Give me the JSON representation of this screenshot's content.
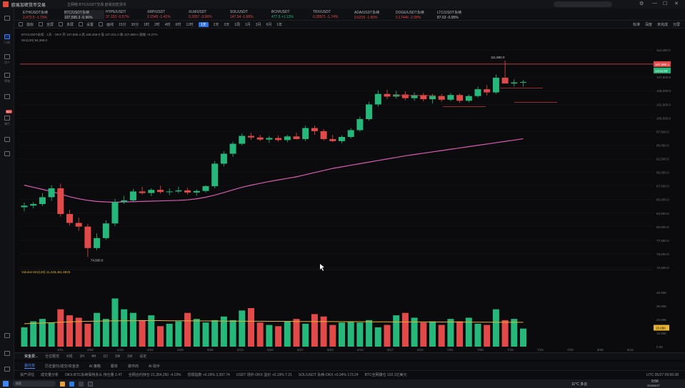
{
  "window": {
    "title": "欧易加密货币交易",
    "title_tabs": "主网络  BTC/USDT交易  欧易加密货币",
    "search_placeholder": "搜索币种 / 功能",
    "controls": [
      "—",
      "☐",
      "✕"
    ]
  },
  "sidebar": {
    "items": [
      {
        "icon": "exchange-icon",
        "label": "交易"
      },
      {
        "icon": "chart-icon",
        "label": "行情"
      },
      {
        "icon": "wallet-icon",
        "label": "资产"
      },
      {
        "icon": "bot-icon",
        "label": "策略"
      },
      {
        "icon": "earn-icon",
        "label": "赚币"
      },
      {
        "icon": "grid-icon",
        "label": "更多"
      },
      {
        "icon": "settings-icon",
        "label": "设置"
      }
    ],
    "badge": "99+"
  },
  "tickers": [
    {
      "name": "ETH/USDT永续",
      "price": "2,472.5 -1.73%",
      "dir": "down"
    },
    {
      "name": "BTC/USDT永续",
      "price": "107,595.3 -0.96%",
      "dir": "neutral",
      "active": true
    },
    {
      "name": "HYPE/USDT",
      "price": "37.153 -0.57%",
      "dir": "down"
    },
    {
      "name": "XRP/USDT",
      "price": "2.1545 -1.41%",
      "dir": "down"
    },
    {
      "name": "XLM/USDT",
      "price": "0.2657 -3.06%",
      "dir": "down"
    },
    {
      "name": "SOL/USDT",
      "price": "147.54 -1.68%",
      "dir": "down"
    },
    {
      "name": "BCH/USDT",
      "price": "477.5 +1.13%",
      "dir": "up"
    },
    {
      "name": "TRX/USDT",
      "price": "0.28571 -1.74%",
      "dir": "down"
    },
    {
      "name": "ADA/USDT永续",
      "price": "0.6215 -1.90%",
      "dir": "down"
    },
    {
      "name": "DOGE/USDT永续",
      "price": "0.17446 -2.08%",
      "dir": "down"
    },
    {
      "name": "LTC/USDT永续",
      "price": "87.63 -0.95%",
      "dir": "neutral"
    }
  ],
  "toolbar": {
    "left_items": [
      "指标",
      "全屏",
      "多屏",
      "设置",
      "画线"
    ],
    "timeframes": [
      "15分",
      "30分",
      "1时",
      "2时",
      "4时",
      "6时",
      "12时",
      "1天",
      "2天",
      "3天",
      "1周",
      "1月",
      "3月",
      "6月",
      "1年"
    ],
    "active_timeframe": "1天",
    "right_items": [
      "标准",
      "深度",
      "未完成",
      "分屏"
    ]
  },
  "chart": {
    "info_line1": "BTC/USDT永续 · 1天 · OKX  开 107,595.3  高 108,268.9  低 107,011.0  收 107,880.0  涨幅 +0.27%",
    "info_line2": "MA(120) 94,368.8",
    "high_label": "111,980.0",
    "low_label": "74,500.0",
    "current_price": "107,880.1",
    "countdown": "14:51:03",
    "volume_label": "Volume  MA(120) 11,428,461.8833",
    "volume_current": "15.68K",
    "price_axis": [
      "112,500.0",
      "110,000.0",
      "107,500.0",
      "105,000.0",
      "102,500.0",
      "100,000.0",
      "97,500.0",
      "95,000.0",
      "92,500.0",
      "90,000.0",
      "87,500.0",
      "85,000.0",
      "82,500.0",
      "80,000.0",
      "77,500.0",
      "75,000.0",
      "72,500.0"
    ],
    "volume_axis": [
      "40.00K",
      "30.00K",
      "20.00K",
      "10.00K",
      "0.00"
    ],
    "date_axis": [
      "4/01",
      "4/08",
      "4/15",
      "4/22",
      "4/29",
      "5/06",
      "5/13",
      "5/20",
      "5/27",
      "6/03",
      "6/10",
      "6/17",
      "6/24",
      "7/01",
      "7/08",
      "7/15",
      "7/22",
      "7/29",
      "8/05",
      "8/12"
    ]
  },
  "chart_data": {
    "type": "candlestick",
    "title": "BTC/USDT永续 1天",
    "x": [
      "4/02",
      "4/03",
      "4/05",
      "4/07",
      "4/09",
      "4/11",
      "4/13",
      "4/15",
      "4/17",
      "4/19",
      "4/21",
      "4/23",
      "4/25",
      "4/27",
      "4/29",
      "5/01",
      "5/03",
      "5/05",
      "5/07",
      "5/09",
      "5/11",
      "5/13",
      "5/15",
      "5/17",
      "5/19",
      "5/21",
      "5/23",
      "5/25",
      "5/27",
      "5/29",
      "5/31",
      "6/02",
      "6/04",
      "6/06",
      "6/08",
      "6/10",
      "6/12",
      "6/14",
      "6/16",
      "6/18",
      "6/20",
      "6/22",
      "6/24",
      "6/26",
      "6/28",
      "6/30",
      "7/02",
      "7/04",
      "7/06",
      "7/08",
      "7/10",
      "7/12",
      "7/14",
      "7/16",
      "7/18",
      "7/20"
    ],
    "ohlc": [
      [
        84000,
        84900,
        83200,
        84300
      ],
      [
        84300,
        85000,
        83800,
        84600
      ],
      [
        84600,
        86700,
        84200,
        85900
      ],
      [
        85900,
        88200,
        85200,
        87600
      ],
      [
        87600,
        88500,
        82200,
        82700
      ],
      [
        82700,
        83500,
        80500,
        81000
      ],
      [
        81000,
        82000,
        79500,
        80300
      ],
      [
        80300,
        80800,
        74500,
        76200
      ],
      [
        76200,
        79000,
        75800,
        78100
      ],
      [
        78100,
        81500,
        77800,
        80900
      ],
      [
        80900,
        85600,
        80400,
        85000
      ],
      [
        85000,
        86200,
        84600,
        85300
      ],
      [
        85300,
        87500,
        85000,
        87000
      ],
      [
        87000,
        87900,
        86400,
        86700
      ],
      [
        86700,
        87600,
        86100,
        87300
      ],
      [
        87300,
        88100,
        86600,
        86900
      ],
      [
        86900,
        87600,
        86300,
        87000
      ],
      [
        87000,
        87900,
        86700,
        87200
      ],
      [
        87200,
        87700,
        86400,
        86800
      ],
      [
        86800,
        87400,
        86200,
        87100
      ],
      [
        87100,
        88200,
        86800,
        88000
      ],
      [
        88000,
        92800,
        87600,
        92300
      ],
      [
        92300,
        94700,
        91800,
        94200
      ],
      [
        94200,
        96500,
        93600,
        96100
      ],
      [
        96100,
        98100,
        95800,
        97600
      ],
      [
        97600,
        98200,
        96800,
        97300
      ],
      [
        97300,
        97800,
        96600,
        96900
      ],
      [
        96900,
        97600,
        96300,
        97200
      ],
      [
        97200,
        97700,
        96500,
        96800
      ],
      [
        96800,
        97800,
        96400,
        97500
      ],
      [
        97500,
        98200,
        96900,
        97000
      ],
      [
        97000,
        99600,
        96600,
        99100
      ],
      [
        99100,
        99600,
        97800,
        98500
      ],
      [
        98500,
        98900,
        96700,
        97000
      ],
      [
        97000,
        97800,
        96400,
        96600
      ],
      [
        96600,
        97700,
        96200,
        97400
      ],
      [
        97400,
        99100,
        97100,
        98700
      ],
      [
        98700,
        101300,
        98400,
        100800
      ],
      [
        100800,
        104100,
        100500,
        103600
      ],
      [
        103600,
        106300,
        103200,
        105600
      ],
      [
        105600,
        106400,
        104600,
        105100
      ],
      [
        105100,
        106200,
        104700,
        105500
      ],
      [
        105500,
        106100,
        104400,
        104800
      ],
      [
        104800,
        105900,
        104300,
        105400
      ],
      [
        105400,
        105800,
        104200,
        104600
      ],
      [
        104600,
        105600,
        103800,
        105200
      ],
      [
        105200,
        105600,
        104100,
        104500
      ],
      [
        104500,
        105800,
        104200,
        105400
      ],
      [
        105400,
        105700,
        103900,
        104300
      ],
      [
        104300,
        105500,
        104000,
        105200
      ],
      [
        105200,
        107000,
        104900,
        106500
      ],
      [
        106500,
        107300,
        105300,
        105900
      ],
      [
        105900,
        109300,
        105600,
        108700
      ],
      [
        108700,
        111980,
        108300,
        107600
      ],
      [
        107600,
        108400,
        107000,
        107800
      ],
      [
        107800,
        108268,
        107011,
        107880
      ]
    ],
    "ma120": [
      88200,
      87800,
      87400,
      87000,
      86500,
      86000,
      85600,
      85300,
      85100,
      85000,
      84950,
      85000,
      85050,
      85100,
      85150,
      85200,
      85250,
      85300,
      85400,
      85600,
      85900,
      86300,
      86800,
      87300,
      87800,
      88200,
      88550,
      88900,
      89200,
      89500,
      89800,
      90200,
      90600,
      91000,
      91400,
      91700,
      92000,
      92300,
      92600,
      92900,
      93200,
      93500,
      93800,
      94050,
      94300,
      94550,
      94800,
      95050,
      95300,
      95550,
      95800,
      96050,
      96300,
      96550,
      96800,
      97050
    ],
    "volume": [
      16,
      21,
      23,
      20,
      31,
      26,
      24,
      19,
      28,
      23,
      40,
      31,
      28,
      22,
      26,
      17,
      19,
      21,
      28,
      23,
      20,
      22,
      25,
      22,
      30,
      32,
      20,
      18,
      17,
      21,
      23,
      19,
      27,
      25,
      18,
      20,
      21,
      20,
      22,
      16,
      18,
      26,
      28,
      24,
      20,
      21,
      18,
      23,
      21,
      24,
      19,
      18,
      31,
      22,
      23,
      15
    ],
    "volume_ma": [
      19,
      19.3,
      19.6,
      19.9,
      20.3,
      20.6,
      20.9,
      21,
      21.2,
      21.3,
      21.4,
      21.5,
      21.5,
      21.6,
      21.6,
      21.6,
      21.5,
      21.5,
      21.4,
      21.4,
      21.3,
      21.3,
      21.2,
      21.2,
      21.2,
      21.1,
      21.1,
      21,
      21,
      21,
      20.9,
      20.9,
      20.8,
      20.8,
      20.8,
      20.7,
      20.7,
      20.7,
      20.6,
      20.6,
      20.6,
      20.5,
      20.5,
      20.5,
      20.5,
      20.4,
      20.4,
      20.4,
      20.4,
      20.3,
      20.3,
      20.3,
      20.3,
      20.2,
      20.2,
      20.2
    ],
    "ylim": [
      72500,
      114000
    ],
    "volume_ylim": [
      0,
      45
    ],
    "colors": {
      "up": "#26b77a",
      "down": "#e24a4a",
      "ma": "#d85cb0",
      "volume_ma": "#e8b430",
      "price_line": "#e24a4a"
    }
  },
  "bottom_tabs": {
    "items": [
      "资金费...",
      "仓位概览",
      "K线",
      "1H",
      "4H",
      "1D",
      "1W",
      "1M",
      "设定"
    ],
    "active": 0
  },
  "bottom_tabs2": {
    "items": [
      "委托单",
      "历史委托/成交/资金流",
      "AI 策略",
      "跟单",
      "做市商",
      "AI 助手"
    ],
    "active": 0
  },
  "status": {
    "items": [
      {
        "text": "资产评估",
        "cls": "neutral"
      },
      {
        "text": "成交量分析",
        "cls": "up"
      },
      {
        "text": "OKX-BTC永续保持多头  持仓量 2.47",
        "cls": "neutral"
      },
      {
        "text": "全网合约持仓 21,354,250  -4.19%",
        "cls": "down"
      },
      {
        "text": "恐惧指数 +0.18%  3,397.74",
        "cls": "up"
      },
      {
        "text": "USDT 场外-OKX  溢价 +0.19%  7.21",
        "cls": "up"
      },
      {
        "text": "SOL/USDT 永续-OKX  +0.34%  173.24",
        "cls": "up"
      },
      {
        "text": "BTC全网爆仓 102.1亿美元",
        "cls": "neutral"
      }
    ],
    "server_time": "UTC 05/27 09:56:38"
  },
  "taskbar": {
    "search_placeholder": "搜索",
    "weather": "11°C 多云",
    "time": "9:56",
    "date": "2025/5/27"
  }
}
